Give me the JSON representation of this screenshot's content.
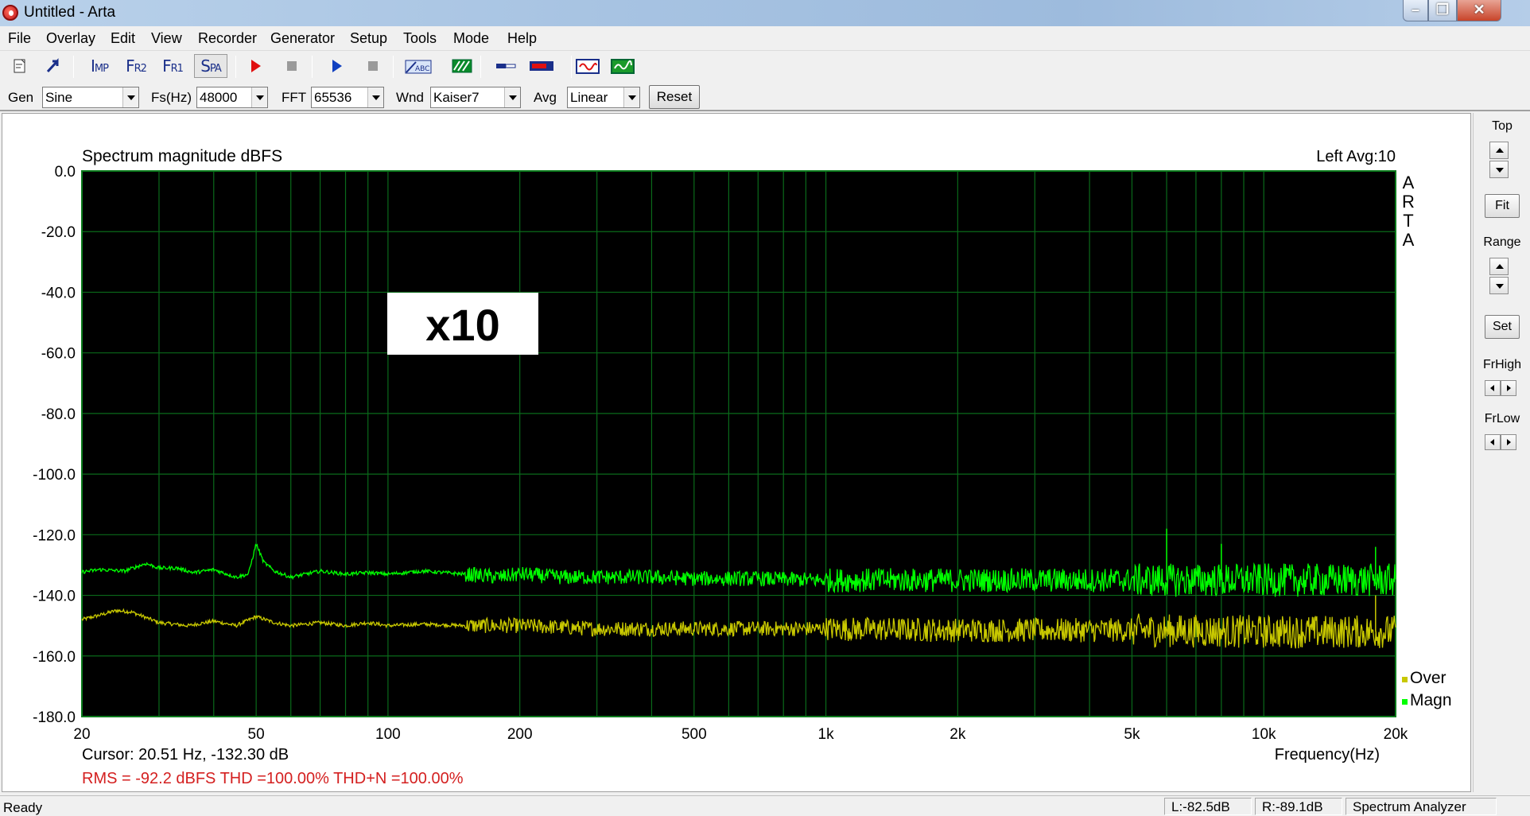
{
  "window": {
    "title": "Untitled - Arta"
  },
  "menu": [
    "File",
    "Overlay",
    "Edit",
    "View",
    "Recorder",
    "Generator",
    "Setup",
    "Tools",
    "Mode",
    "Help"
  ],
  "toolbar": {
    "imp": {
      "big": "I",
      "small": "MP"
    },
    "fr2": {
      "big": "F",
      "small": "R2"
    },
    "fr1": {
      "big": "F",
      "small": "R1"
    },
    "spa": {
      "big": "S",
      "small": "PA"
    }
  },
  "params": {
    "gen_label": "Gen",
    "gen_value": "Sine",
    "fs_label": "Fs(Hz)",
    "fs_value": "48000",
    "fft_label": "FFT",
    "fft_value": "65536",
    "wnd_label": "Wnd",
    "wnd_value": "Kaiser7",
    "avg_label": "Avg",
    "avg_value": "Linear",
    "reset_label": "Reset"
  },
  "plot": {
    "title": "Spectrum magnitude dBFS",
    "channel_info": "Left  Avg:10",
    "watermark": [
      "A",
      "R",
      "T",
      "A"
    ],
    "overlay_text": "x10",
    "cursor": "Cursor: 20.51 Hz, -132.30 dB",
    "measurements": "RMS =  -92.2 dBFS   THD =100.00%   THD+N =100.00%"
  },
  "chart_data": {
    "type": "line",
    "title": "Spectrum magnitude dBFS",
    "xlabel": "Frequency(Hz)",
    "ylabel": "",
    "xscale": "log",
    "xlim": [
      20,
      20000
    ],
    "ylim": [
      -180,
      0
    ],
    "grid": true,
    "legend_position": "bottom-right",
    "y_ticks": [
      0,
      -20,
      -40,
      -60,
      -80,
      -100,
      -120,
      -140,
      -160,
      -180
    ],
    "y_tick_labels": [
      "0.0",
      "-20.0",
      "-40.0",
      "-60.0",
      "-80.0",
      "-100.0",
      "-120.0",
      "-140.0",
      "-160.0",
      "-180.0"
    ],
    "x_ticks": [
      20,
      50,
      100,
      200,
      500,
      1000,
      2000,
      5000,
      10000,
      20000
    ],
    "x_tick_labels": [
      "20",
      "50",
      "100",
      "200",
      "500",
      "1k",
      "2k",
      "5k",
      "10k",
      "20k"
    ],
    "series": [
      {
        "name": "Magn",
        "color": "#00ff00",
        "x": [
          20,
          22,
          25,
          28,
          30,
          33,
          36,
          40,
          45,
          48,
          50,
          52,
          55,
          60,
          70,
          80,
          90,
          100,
          120,
          150,
          180,
          200,
          250,
          300,
          400,
          500,
          700,
          1000,
          1500,
          2000,
          3000,
          5000,
          6000,
          7000,
          8000,
          10000,
          15000,
          18000,
          20000
        ],
        "y": [
          -132.3,
          -131.5,
          -132,
          -129.5,
          -131,
          -131,
          -132.5,
          -131.5,
          -134,
          -133,
          -123,
          -129,
          -132,
          -134,
          -132,
          -133,
          -132.5,
          -133,
          -132,
          -133,
          -134,
          -133,
          -134,
          -134,
          -134,
          -134.5,
          -134.5,
          -135,
          -135,
          -135,
          -135,
          -135,
          -135,
          -135,
          -135,
          -135,
          -135,
          -135,
          -135
        ]
      },
      {
        "name": "Over",
        "color": "#c8c800",
        "x": [
          20,
          22,
          24,
          26,
          30,
          35,
          40,
          45,
          50,
          55,
          60,
          70,
          80,
          90,
          100,
          120,
          150,
          200,
          300,
          500,
          1000,
          2000,
          5000,
          10000,
          20000
        ],
        "y": [
          -148,
          -146.5,
          -145,
          -145.5,
          -149,
          -150,
          -148.5,
          -150,
          -147,
          -149,
          -150,
          -149,
          -150,
          -149,
          -150,
          -149.5,
          -150,
          -150,
          -151,
          -151,
          -151,
          -151.5,
          -151.5,
          -152,
          -152
        ]
      }
    ],
    "spurs": [
      {
        "series": "Magn",
        "x": 6000,
        "y": -118
      },
      {
        "series": "Magn",
        "x": 8000,
        "y": -123
      },
      {
        "series": "Magn",
        "x": 18000,
        "y": -124
      },
      {
        "series": "Over",
        "x": 18000,
        "y": -140
      }
    ]
  },
  "right_panel": {
    "top_label": "Top",
    "fit_label": "Fit",
    "range_label": "Range",
    "set_label": "Set",
    "frhigh_label": "FrHigh",
    "frlow_label": "FrLow"
  },
  "status": {
    "ready": "Ready",
    "left_level": "L:-82.5dB",
    "right_level": "R:-89.1dB",
    "mode": "Spectrum Analyzer"
  }
}
